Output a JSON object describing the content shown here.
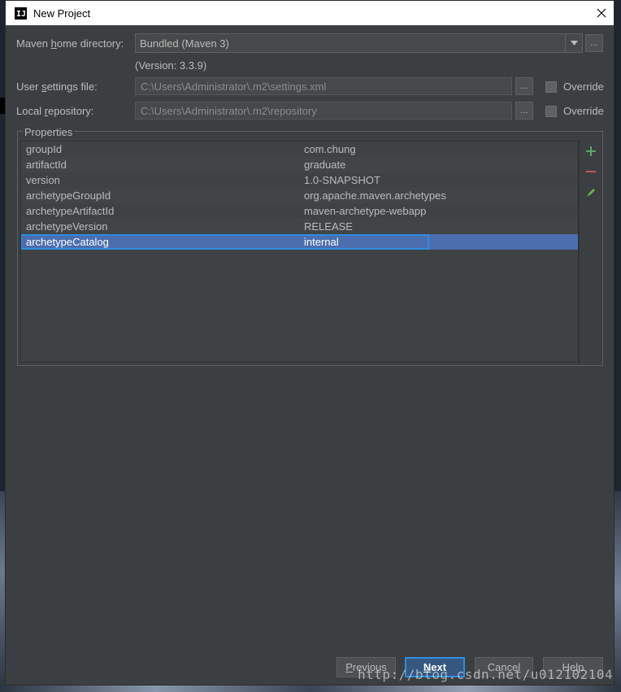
{
  "window": {
    "title": "New Project",
    "app_icon": "IJ"
  },
  "maven_home": {
    "label_pre": "Maven ",
    "label_mnemonic": "h",
    "label_post": "ome directory:",
    "value": "Bundled (Maven 3)",
    "version": "(Version: 3.3.9)"
  },
  "user_settings": {
    "label_pre": "User ",
    "label_mnemonic": "s",
    "label_post": "ettings file:",
    "value": "C:\\Users\\Administrator\\.m2\\settings.xml",
    "override_label": "Override"
  },
  "local_repo": {
    "label_pre": "Local ",
    "label_mnemonic": "r",
    "label_post": "epository:",
    "value": "C:\\Users\\Administrator\\.m2\\repository",
    "override_label": "Override"
  },
  "browse_label": "...",
  "properties": {
    "title": "Properties",
    "rows": [
      {
        "key": "groupId",
        "value": "com.chung"
      },
      {
        "key": "artifactId",
        "value": "graduate"
      },
      {
        "key": "version",
        "value": "1.0-SNAPSHOT"
      },
      {
        "key": "archetypeGroupId",
        "value": "org.apache.maven.archetypes"
      },
      {
        "key": "archetypeArtifactId",
        "value": "maven-archetype-webapp"
      },
      {
        "key": "archetypeVersion",
        "value": "RELEASE"
      },
      {
        "key": "archetypeCatalog",
        "value": "internal"
      }
    ],
    "selected_row": "archetypeCatalog"
  },
  "buttons": {
    "previous_mnemonic": "P",
    "previous_rest": "revious",
    "next_mnemonic": "N",
    "next_rest": "ext",
    "cancel": "Cancel",
    "help": "Help"
  },
  "watermark": "http://blog.csdn.net/u012102104",
  "colors": {
    "background": "#3c3f41",
    "selection": "#4b6eaf",
    "focus": "#2f8ce0",
    "add": "#59a869",
    "remove": "#c75450",
    "edit": "#62b543"
  }
}
